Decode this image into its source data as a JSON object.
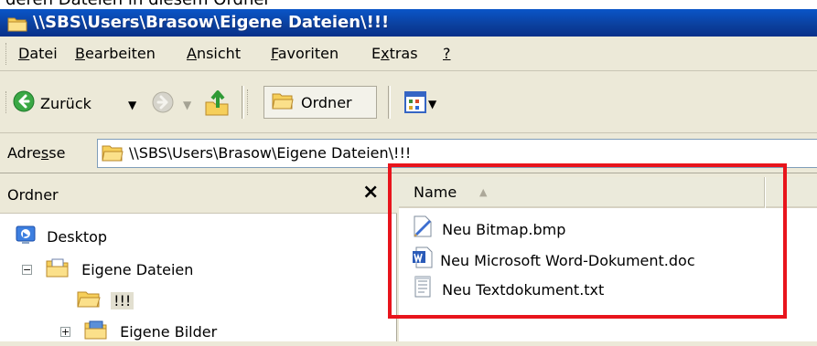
{
  "partial_caption": "deren Dateien in diesem Ordner",
  "window": {
    "title": "\\\\SBS\\Users\\Brasow\\Eigene Dateien\\!!!",
    "icon": "folder-icon"
  },
  "menu": {
    "items": [
      {
        "label": "Datei",
        "accel": "D",
        "rest": "atei"
      },
      {
        "label": "Bearbeiten",
        "accel": "B",
        "rest": "earbeiten"
      },
      {
        "label": "Ansicht",
        "accel": "A",
        "rest": "nsicht"
      },
      {
        "label": "Favoriten",
        "accel": "F",
        "rest": "avoriten"
      },
      {
        "label": "Extras",
        "pre": "E",
        "accel": "x",
        "rest": "tras"
      },
      {
        "label": "?",
        "accel": "?"
      }
    ]
  },
  "toolbar": {
    "back_label": "Zurück",
    "folders_label": "Ordner",
    "icons": [
      "back-arrow-icon",
      "forward-arrow-icon",
      "up-folder-icon",
      "folder-icon",
      "views-icon"
    ]
  },
  "address": {
    "label_pre": "Adre",
    "label_accel": "s",
    "label_post": "se",
    "value": "\\\\SBS\\Users\\Brasow\\Eigene Dateien\\!!!"
  },
  "folders_pane": {
    "title": "Ordner",
    "close_glyph": "×",
    "tree": [
      {
        "label": "Desktop",
        "icon": "desktop-icon"
      },
      {
        "label": "Eigene Dateien",
        "icon": "my-documents-icon",
        "expander": "−"
      },
      {
        "label": "!!!",
        "icon": "folder-icon",
        "selected": true
      },
      {
        "label": "Eigene Bilder",
        "icon": "my-pictures-icon",
        "expander": "+"
      }
    ]
  },
  "files_pane": {
    "column_name": "Name",
    "sort_glyph": "▲",
    "files": [
      {
        "name": "Neu Bitmap.bmp",
        "icon": "bitmap-file-icon"
      },
      {
        "name": "Neu Microsoft Word-Dokument.doc",
        "icon": "word-document-icon"
      },
      {
        "name": "Neu Textdokument.txt",
        "icon": "text-document-icon"
      }
    ]
  },
  "colors": {
    "titlebar": "#0b3f9c",
    "window_face": "#ece9d8",
    "folder_yellow": "#f6cf5a",
    "highlight_red": "#e8141c",
    "selection": "#ece9d8"
  }
}
